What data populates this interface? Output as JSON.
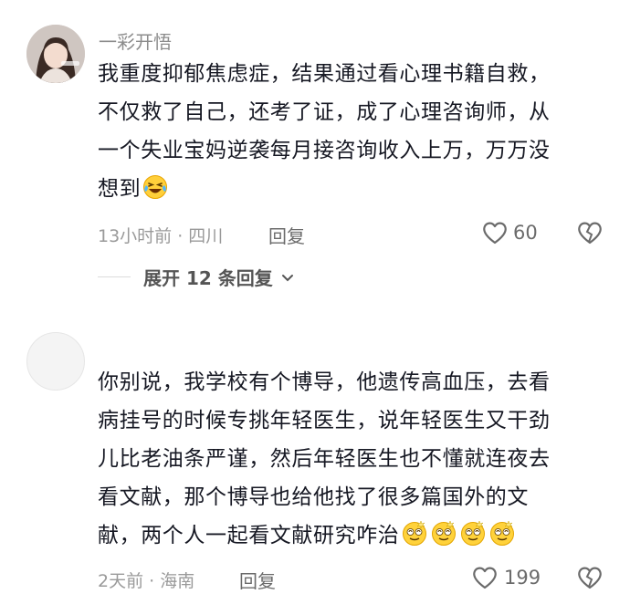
{
  "comments": [
    {
      "username": "一彩开悟",
      "avatar_icon": "user-avatar-photo",
      "text": "我重度抑郁焦虑症，结果通过看心理书籍自救，\n不仅救了自己，还考了证，成了心理咨询师，从\n一个失业宝妈逆袭每月接咨询收入上万，万万没\n想到",
      "emoji": "laughing-crying-emoji",
      "time_location": "13小时前 · 四川",
      "reply_label": "回复",
      "likes": "60",
      "expand_label": "展开 12 条回复"
    },
    {
      "username": "",
      "avatar_icon": "blank-avatar",
      "text": "你别说，我学校有个博导，他遗传高血压，去看\n病挂号的时候专挑年轻医生，说年轻医生又干劲\n儿比老油条严谨，然后年轻医生也不懂就连夜去\n看文献，那个博导也给他找了很多篇国外的文\n献，两个人一起看文献研究咋治",
      "emoji": "dizzy-face-emoji",
      "time_location": "2天前 · 海南",
      "reply_label": "回复",
      "likes": "199"
    }
  ],
  "colors": {
    "text": "#161823",
    "meta": "#9a9a9a",
    "icon": "#6b6b6b"
  }
}
